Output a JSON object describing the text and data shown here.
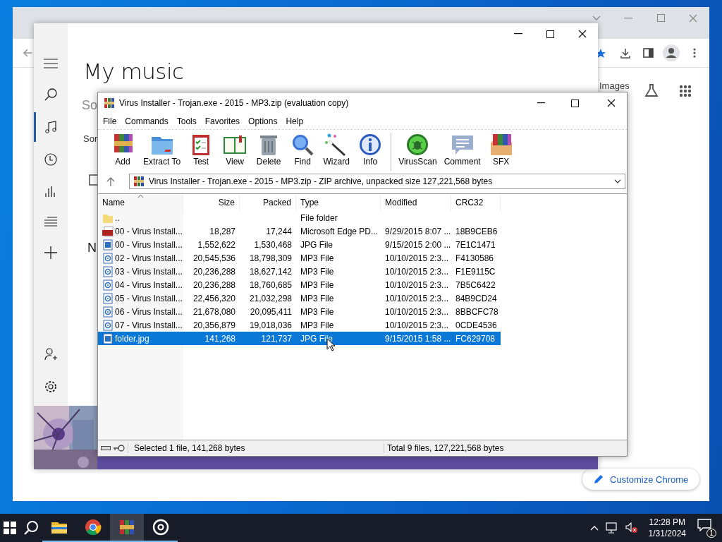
{
  "browser": {
    "images_link": "Images",
    "customize_button": "Customize Chrome"
  },
  "music_app": {
    "title": "My music",
    "cut_texts": [
      "So",
      "Sor",
      "N"
    ],
    "checkbox_checked": false
  },
  "archiver": {
    "title": "Virus Installer - Trojan.exe - 2015 - MP3.zip (evaluation copy)",
    "menu": [
      "File",
      "Commands",
      "Tools",
      "Favorites",
      "Options",
      "Help"
    ],
    "toolbar": [
      {
        "label": "Add",
        "kind": "add"
      },
      {
        "label": "Extract To",
        "kind": "extract"
      },
      {
        "label": "Test",
        "kind": "test"
      },
      {
        "label": "View",
        "kind": "view"
      },
      {
        "label": "Delete",
        "kind": "delete"
      },
      {
        "label": "Find",
        "kind": "find"
      },
      {
        "label": "Wizard",
        "kind": "wizard"
      },
      {
        "label": "Info",
        "kind": "info"
      },
      {
        "label": "VirusScan",
        "kind": "virusscan"
      },
      {
        "label": "Comment",
        "kind": "comment"
      },
      {
        "label": "SFX",
        "kind": "sfx"
      }
    ],
    "path": "Virus Installer - Trojan.exe - 2015 - MP3.zip - ZIP archive, unpacked size 127,221,568 bytes",
    "columns": [
      {
        "label": "Name",
        "sorted": true
      },
      {
        "label": "Size",
        "sorted": false
      },
      {
        "label": "Packed",
        "sorted": false
      },
      {
        "label": "Type",
        "sorted": false
      },
      {
        "label": "Modified",
        "sorted": false
      },
      {
        "label": "CRC32",
        "sorted": false
      }
    ],
    "rows": [
      {
        "kind": "folder",
        "name": "..",
        "size": "",
        "packed": "",
        "type": "File folder",
        "modified": "",
        "crc": "",
        "selected": false
      },
      {
        "kind": "pdf",
        "name": "00 - Virus Install...",
        "size": "18,287",
        "packed": "17,244",
        "type": "Microsoft Edge PD...",
        "modified": "9/29/2015 8:07 ...",
        "crc": "18B9CEB6",
        "selected": false
      },
      {
        "kind": "jpg",
        "name": "00 - Virus Install...",
        "size": "1,552,622",
        "packed": "1,530,468",
        "type": "JPG File",
        "modified": "9/15/2015 2:00 ...",
        "crc": "7E1C1471",
        "selected": false
      },
      {
        "kind": "mp3",
        "name": "02 - Virus Install...",
        "size": "20,545,536",
        "packed": "18,798,309",
        "type": "MP3 File",
        "modified": "10/10/2015 2:3...",
        "crc": "F4130586",
        "selected": false
      },
      {
        "kind": "mp3",
        "name": "03 - Virus Install...",
        "size": "20,236,288",
        "packed": "18,627,142",
        "type": "MP3 File",
        "modified": "10/10/2015 2:3...",
        "crc": "F1E9115C",
        "selected": false
      },
      {
        "kind": "mp3",
        "name": "04 - Virus Install...",
        "size": "20,236,288",
        "packed": "18,760,685",
        "type": "MP3 File",
        "modified": "10/10/2015 2:3...",
        "crc": "7B5C6422",
        "selected": false
      },
      {
        "kind": "mp3",
        "name": "05 - Virus Install...",
        "size": "22,456,320",
        "packed": "21,032,298",
        "type": "MP3 File",
        "modified": "10/10/2015 2:3...",
        "crc": "84B9CD24",
        "selected": false
      },
      {
        "kind": "mp3",
        "name": "06 - Virus Install...",
        "size": "21,678,080",
        "packed": "20,095,411",
        "type": "MP3 File",
        "modified": "10/10/2015 2:3...",
        "crc": "8BBCFC78",
        "selected": false
      },
      {
        "kind": "mp3",
        "name": "07 - Virus Install...",
        "size": "20,356,879",
        "packed": "19,018,036",
        "type": "MP3 File",
        "modified": "10/10/2015 2:3...",
        "crc": "0CDE4536",
        "selected": false
      },
      {
        "kind": "jpg",
        "name": "folder.jpg",
        "size": "141,268",
        "packed": "121,737",
        "type": "JPG File",
        "modified": "9/15/2015 1:58 ...",
        "crc": "FC629708",
        "selected": true
      }
    ],
    "status_left": "Selected 1 file, 141,268 bytes",
    "status_right": "Total 9 files, 127,221,568 bytes"
  },
  "taskbar": {
    "apps": [
      {
        "kind": "explorer",
        "selected": false
      },
      {
        "kind": "chrome",
        "selected": false
      },
      {
        "kind": "archiver",
        "selected": true
      },
      {
        "kind": "groove",
        "selected": false
      }
    ],
    "time": "12:28 PM",
    "date": "1/31/2024",
    "notifications": "1"
  }
}
